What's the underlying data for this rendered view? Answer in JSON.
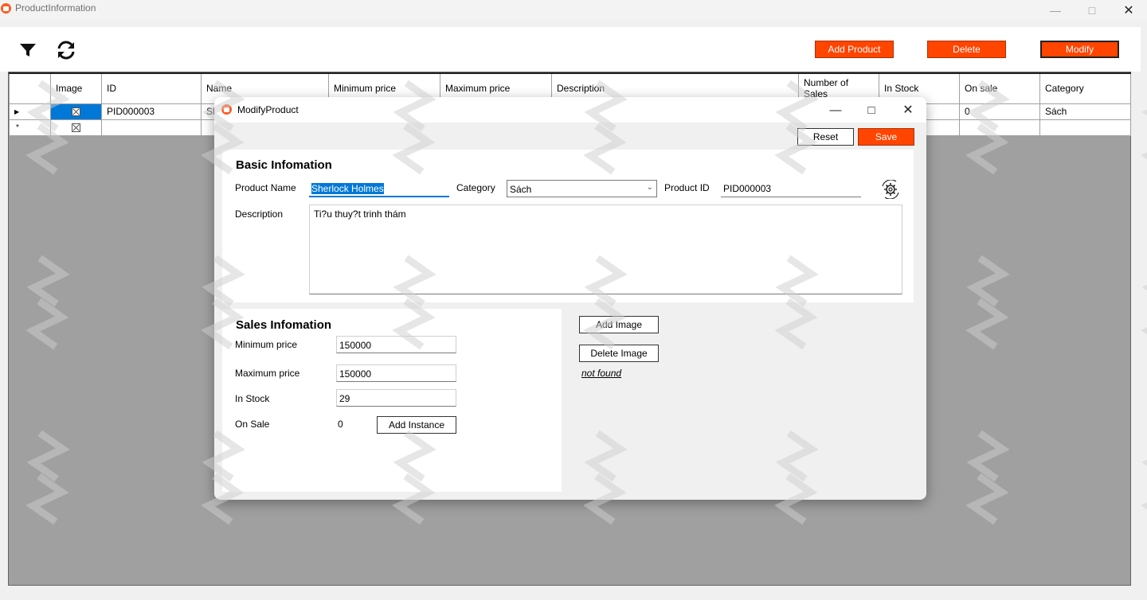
{
  "window": {
    "title": "ProductInformation"
  },
  "toolbar": {
    "filter_icon": "filter-icon",
    "refresh_icon": "refresh-icon",
    "add_product_label": "Add Product",
    "delete_label": "Delete",
    "modify_label": "Modify"
  },
  "grid": {
    "columns": [
      "",
      "Image",
      "ID",
      "Name",
      "Minimum price",
      "Maximum price",
      "Description",
      "Number of Sales",
      "In Stock",
      "On sale",
      "Category"
    ],
    "rows": [
      {
        "marker": "▶",
        "id": "PID000003",
        "name": "Sh",
        "on_sale": "0",
        "category": "Sách"
      },
      {
        "marker": "*",
        "id": "",
        "name": "",
        "on_sale": "",
        "category": ""
      }
    ]
  },
  "modal": {
    "title": "ModifyProduct",
    "reset_label": "Reset",
    "save_label": "Save",
    "basic": {
      "title": "Basic Infomation",
      "product_name_label": "Product Name",
      "product_name_value": "Sherlock Holmes",
      "category_label": "Category",
      "category_value": "Sách",
      "product_id_label": "Product ID",
      "product_id_value": "PID000003",
      "generate_icon": "gear-refresh-icon",
      "description_label": "Description",
      "description_value": "Ti?u thuy?t trinh thám"
    },
    "sales": {
      "title": "Sales Infomation",
      "min_price_label": "Minimum price",
      "min_price_value": "150000",
      "max_price_label": "Maximum price",
      "max_price_value": "150000",
      "in_stock_label": "In Stock",
      "in_stock_value": "29",
      "on_sale_label": "On Sale",
      "on_sale_value": "0",
      "add_instance_label": "Add Instance"
    },
    "image": {
      "add_image_label": "Add Image",
      "delete_image_label": "Delete Image",
      "status_text": "not found"
    }
  },
  "colors": {
    "accent": "#ff4500",
    "selection": "#0078d7"
  }
}
